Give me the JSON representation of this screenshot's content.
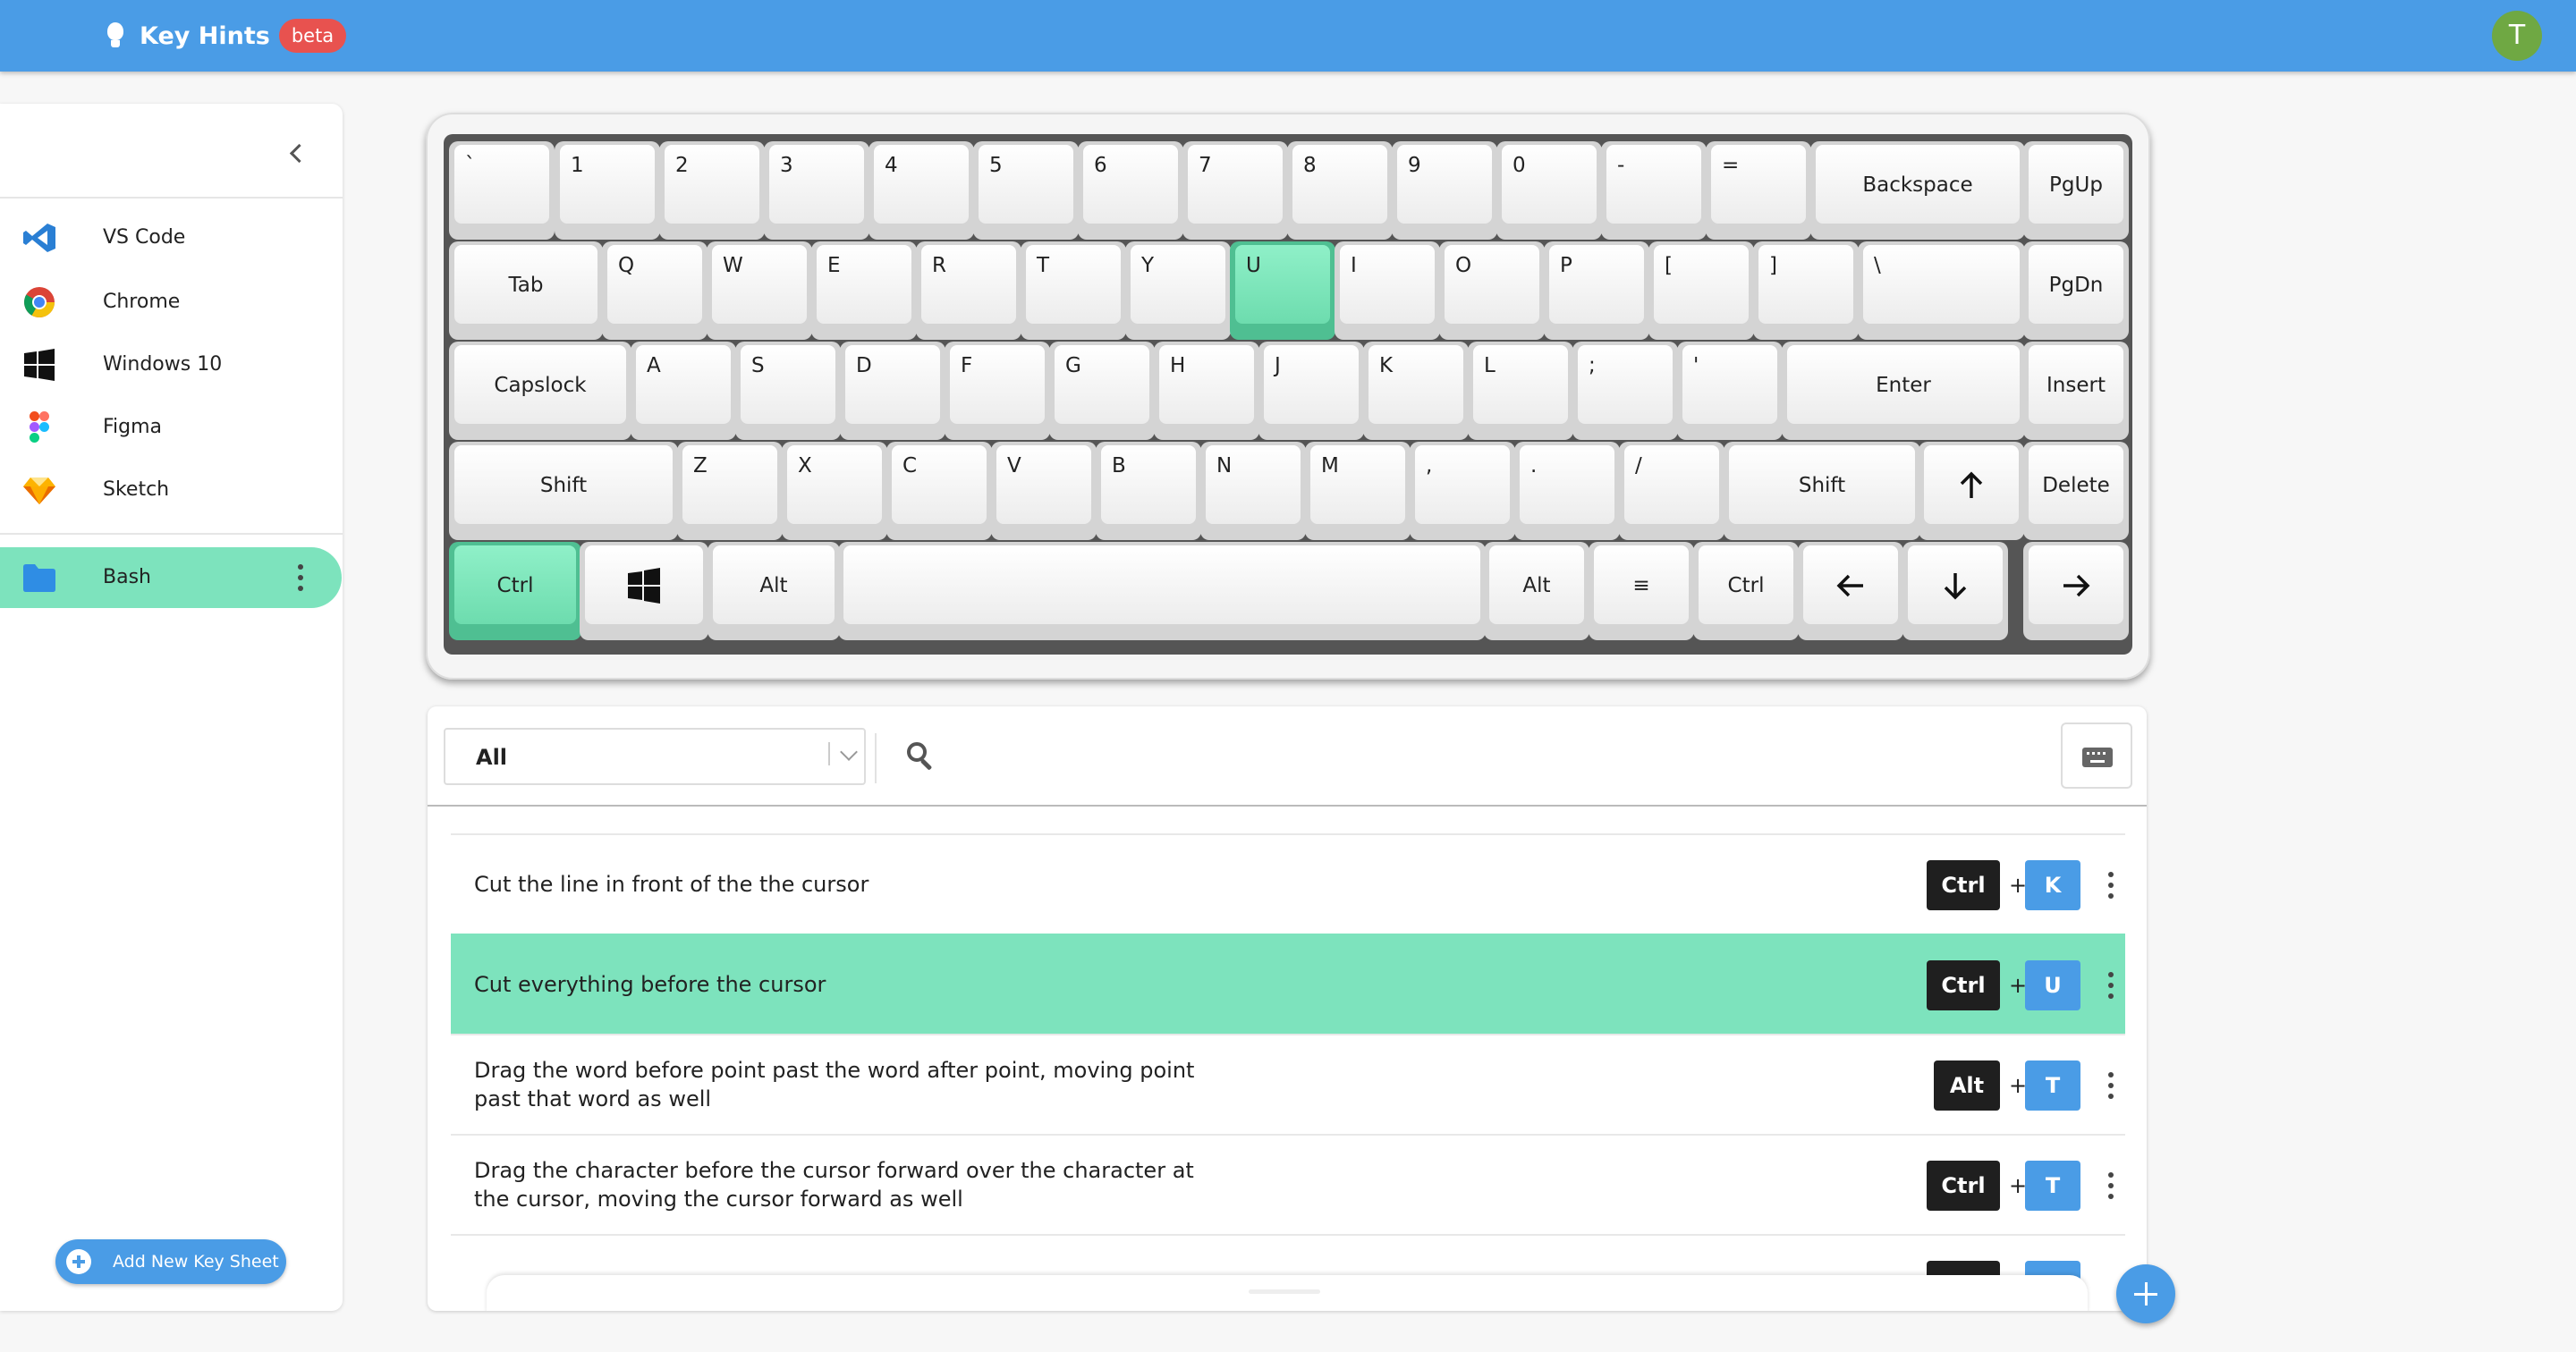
{
  "header": {
    "title": "Key Hints",
    "badge": "beta",
    "avatar_initial": "T"
  },
  "sidebar": {
    "items": [
      {
        "label": "VS Code",
        "icon": "vscode-icon"
      },
      {
        "label": "Chrome",
        "icon": "chrome-icon"
      },
      {
        "label": "Windows 10",
        "icon": "windows-icon"
      },
      {
        "label": "Figma",
        "icon": "figma-icon"
      },
      {
        "label": "Sketch",
        "icon": "sketch-icon"
      }
    ],
    "custom": {
      "label": "Bash",
      "icon": "folder-icon",
      "active": true
    },
    "add_button": "Add New Key Sheet"
  },
  "keyboard": {
    "rows": [
      [
        "`",
        "1",
        "2",
        "3",
        "4",
        "5",
        "6",
        "7",
        "8",
        "9",
        "0",
        "-",
        "=",
        "Backspace",
        "PgUp"
      ],
      [
        "Tab",
        "Q",
        "W",
        "E",
        "R",
        "T",
        "Y",
        "U",
        "I",
        "O",
        "P",
        "[",
        "]",
        "\\",
        "PgDn"
      ],
      [
        "Capslock",
        "A",
        "S",
        "D",
        "F",
        "G",
        "H",
        "J",
        "K",
        "L",
        ";",
        "'",
        "Enter",
        "Insert"
      ],
      [
        "Shift",
        "Z",
        "X",
        "C",
        "V",
        "B",
        "N",
        "M",
        ",",
        ".",
        "/",
        "Shift",
        "↑",
        "Delete"
      ],
      [
        "Ctrl",
        "Win",
        "Alt",
        "",
        "Alt",
        "≡",
        "Ctrl",
        "←",
        "↓",
        "→"
      ]
    ],
    "highlighted": [
      "U",
      "Ctrl"
    ]
  },
  "shortcuts": {
    "filter_value": "All",
    "rows": [
      {
        "description": "Cut the line in front of the the cursor",
        "modifier": "Ctrl",
        "key": "K",
        "highlighted": false
      },
      {
        "description": "Cut everything before the cursor",
        "modifier": "Ctrl",
        "key": "U",
        "highlighted": true
      },
      {
        "description": "Drag the word before point past the word after point, moving point past that word as well",
        "modifier": "Alt",
        "key": "T",
        "highlighted": false
      },
      {
        "description": "Drag the character before the cursor forward over the character at the cursor, moving the cursor forward as well",
        "modifier": "Ctrl",
        "key": "T",
        "highlighted": false
      }
    ]
  },
  "colors": {
    "header": "#4a9ce6",
    "accent": "#7de3bd",
    "key_badge": "#4a9ce6",
    "mod_badge": "#1f1f1f",
    "beta": "#e8524f"
  }
}
